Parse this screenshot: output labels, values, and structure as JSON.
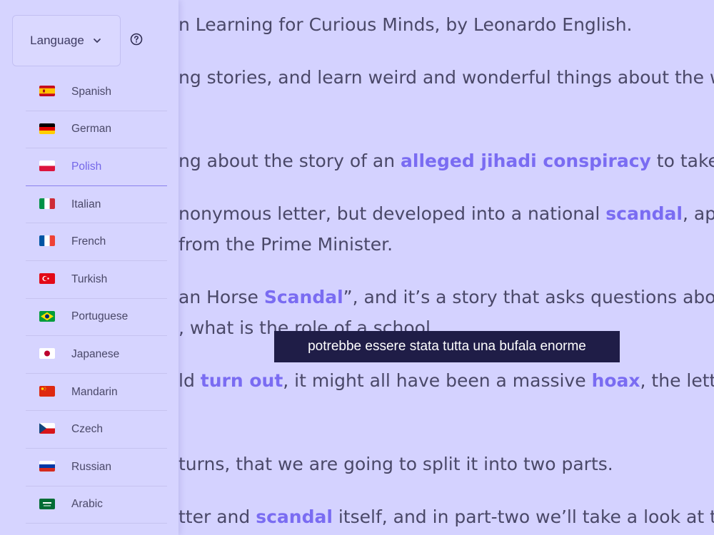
{
  "transcript": {
    "lines": [
      {
        "parts": [
          {
            "t": "n Learning for Curious Minds, by Leonardo English."
          }
        ]
      },
      {
        "parts": [
          {
            "t": "ng stories, and learn weird and wonderful things about the world"
          }
        ]
      },
      {
        "parts": [
          {
            "t": "ng about the story of an "
          },
          {
            "t": "alleged jihadi conspiracy",
            "k": 1
          },
          {
            "t": " to take over"
          }
        ]
      },
      {
        "parts": [
          {
            "t": "nonymous letter, but developed into a national "
          },
          {
            "t": "scandal",
            "k": 1
          },
          {
            "t": ", appeari"
          }
        ]
      },
      {
        "parts": [
          {
            "t": "from the Prime Minister."
          }
        ]
      },
      {
        "parts": [
          {
            "t": "an Horse "
          },
          {
            "t": "Scandal",
            "k": 1
          },
          {
            "t": "”, and it’s a story that asks questions about m"
          }
        ]
      },
      {
        "parts": [
          {
            "t": ", what is the role of a school."
          }
        ]
      },
      {
        "parts": [
          {
            "t": "ld "
          },
          {
            "t": "turn out",
            "k": 1
          },
          {
            "t": ", it might all have been a massive "
          },
          {
            "t": "hoax",
            "k": 1
          },
          {
            "t": ", the letter th"
          }
        ]
      },
      {
        "parts": [
          {
            "t": " turns, that we are going to split it into two parts."
          }
        ]
      },
      {
        "parts": [
          {
            "t": "tter and "
          },
          {
            "t": "scandal",
            "k": 1
          },
          {
            "t": " itself, and in part-two we’ll take a look at the in"
          }
        ]
      }
    ]
  },
  "tooltip": {
    "text": "potrebbe essere stata tutta una bufala enorme"
  },
  "sidebar": {
    "language_button_label": "Language",
    "languages": [
      {
        "label": "Spanish",
        "flag": "spain-flag-icon"
      },
      {
        "label": "German",
        "flag": "germany-flag-icon"
      },
      {
        "label": "Polish",
        "flag": "poland-flag-icon",
        "selected": true
      },
      {
        "label": "Italian",
        "flag": "italy-flag-icon"
      },
      {
        "label": "French",
        "flag": "france-flag-icon"
      },
      {
        "label": "Turkish",
        "flag": "turkey-flag-icon"
      },
      {
        "label": "Portuguese",
        "flag": "brazil-flag-icon"
      },
      {
        "label": "Japanese",
        "flag": "japan-flag-icon"
      },
      {
        "label": "Mandarin",
        "flag": "china-flag-icon"
      },
      {
        "label": "Czech",
        "flag": "czech-flag-icon"
      },
      {
        "label": "Russian",
        "flag": "russia-flag-icon"
      },
      {
        "label": "Arabic",
        "flag": "saudi-arabia-flag-icon"
      }
    ]
  },
  "colors": {
    "background": "#d4d2ff",
    "accent": "#7a6cf2",
    "tooltip_bg": "#1f1d47",
    "text": "#4a4868"
  }
}
